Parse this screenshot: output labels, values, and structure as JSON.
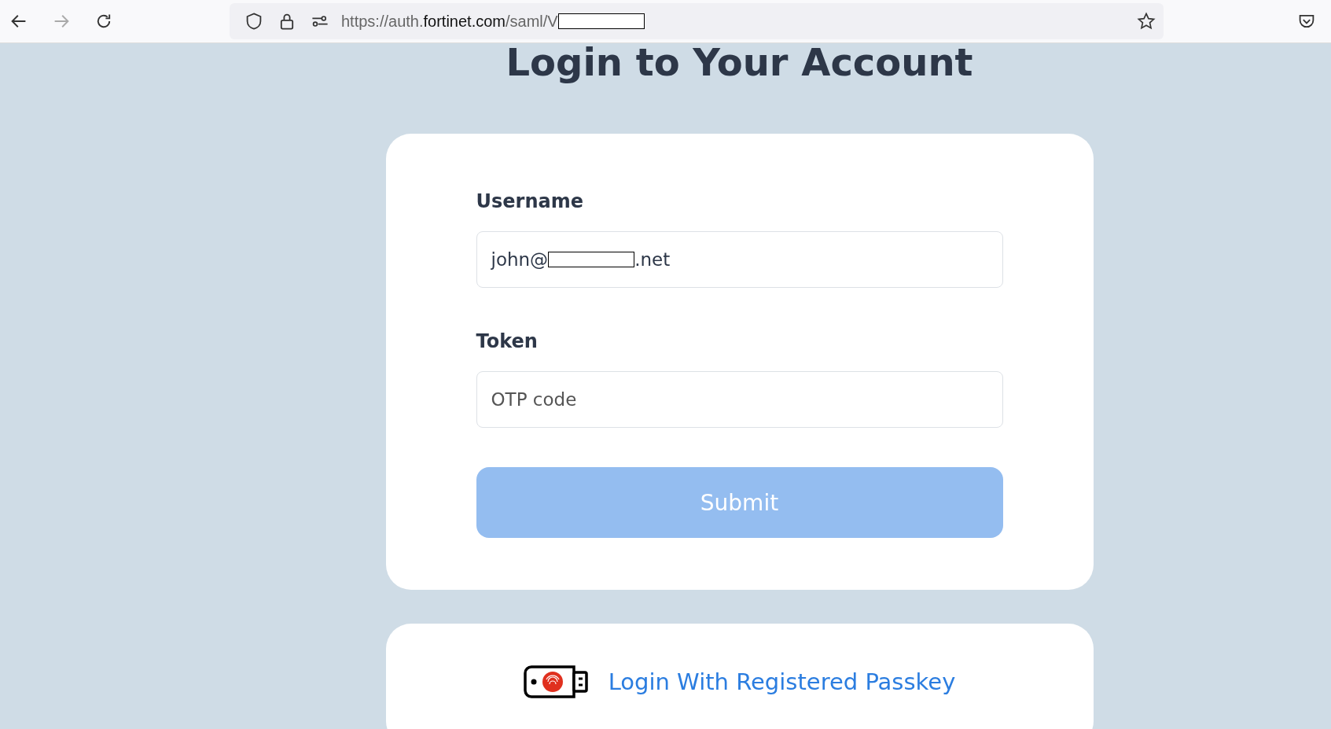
{
  "browser": {
    "url": {
      "scheme": "https://auth.",
      "host": "fortinet.com",
      "path": "/saml/V",
      "redacted": true
    }
  },
  "title": "Login to Your Account",
  "form": {
    "fields": [
      {
        "label": "Username",
        "value": "john@",
        "value_end": ".net",
        "redacted": true
      },
      {
        "label": "Token",
        "placeholder": "OTP code"
      }
    ],
    "submit": {
      "label": "Submit",
      "disabled": true
    }
  },
  "passkey": {
    "label": "Login With Registered Passkey"
  }
}
